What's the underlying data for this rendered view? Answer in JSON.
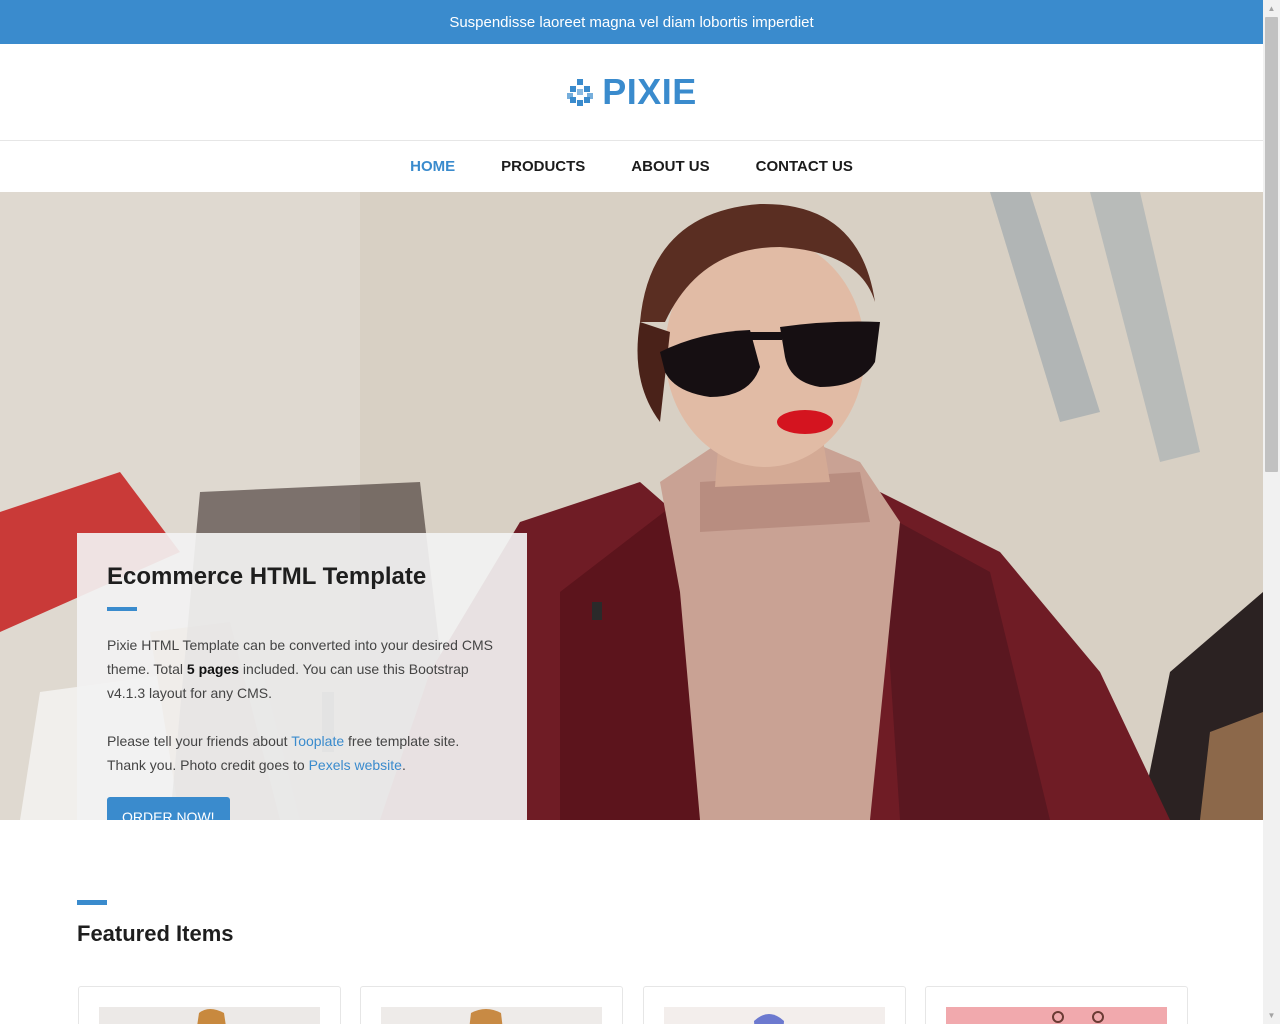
{
  "topbar": {
    "text": "Suspendisse laoreet magna vel diam lobortis imperdiet"
  },
  "brand": {
    "name": "PIXIE",
    "accent": "#3a8bcd",
    "icon": "pixel-diamond-icon"
  },
  "nav": {
    "items": [
      {
        "label": "HOME",
        "active": true
      },
      {
        "label": "PRODUCTS",
        "active": false
      },
      {
        "label": "ABOUT US",
        "active": false
      },
      {
        "label": "CONTACT US",
        "active": false
      }
    ]
  },
  "hero": {
    "title": "Ecommerce HTML Template",
    "p1_before": "Pixie HTML Template can be converted into your desired CMS theme. Total ",
    "p1_bold": "5 pages",
    "p1_after": " included. You can use this Bootstrap v4.1.3 layout for any CMS.",
    "p2_before": "Please tell your friends about ",
    "p2_link1": "Tooplate",
    "p2_mid": " free template site. Thank you. Photo credit goes to ",
    "p2_link2": "Pexels website",
    "p2_end": ".",
    "button_label": "ORDER NOW!",
    "image": "woman-in-sunglasses-with-shopping-bags-photo"
  },
  "featured": {
    "title": "Featured Items",
    "cards": [
      {
        "image": "product-thumbnail"
      },
      {
        "image": "product-thumbnail"
      },
      {
        "image": "product-thumbnail"
      },
      {
        "image": "product-thumbnail"
      }
    ]
  }
}
